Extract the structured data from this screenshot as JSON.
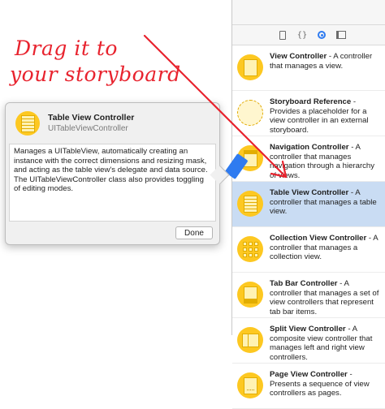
{
  "annotation": {
    "line1": "Drag it to",
    "line2": "your storyboard",
    "color": "#e8232e"
  },
  "library": {
    "tabs": [
      {
        "icon": "file-icon"
      },
      {
        "icon": "braces-icon",
        "label": "{}"
      },
      {
        "icon": "object-library-icon",
        "active": true
      },
      {
        "icon": "media-icon"
      }
    ],
    "items": [
      {
        "title": "View Controller",
        "desc": " - A controller that manages a view.",
        "icon": "view-controller-icon"
      },
      {
        "title": "Storyboard Reference",
        "desc": " - Provides a placeholder for a view controller in an external storyboard.",
        "icon": "storyboard-reference-icon"
      },
      {
        "title": "Navigation Controller",
        "desc": " - A controller that manages navigation through a hierarchy of views.",
        "icon": "navigation-controller-icon"
      },
      {
        "title": "Table View Controller",
        "desc": " - A controller that manages a table view.",
        "icon": "table-view-controller-icon",
        "selected": true
      },
      {
        "title": "Collection View Controller",
        "desc": " - A controller that manages a collection view.",
        "icon": "collection-view-controller-icon"
      },
      {
        "title": "Tab Bar Controller",
        "desc": " - A controller that manages a set of view controllers that represent tab bar items.",
        "icon": "tab-bar-controller-icon"
      },
      {
        "title": "Split View Controller",
        "desc": " - A composite view controller that manages left and right view controllers.",
        "icon": "split-view-controller-icon"
      },
      {
        "title": "Page View Controller",
        "desc": " - Presents a sequence of view controllers as pages.",
        "icon": "page-view-controller-icon"
      }
    ]
  },
  "popover": {
    "title": "Table View Controller",
    "subtitle": "UITableViewController",
    "description": "Manages a UITableView, automatically creating an instance with the correct dimensions and resizing mask, and acting as the table view's delegate and data source. The UITableViewController class also provides toggling of editing modes.",
    "done_label": "Done"
  },
  "colors": {
    "accent": "#2f7bf0",
    "icon_yellow": "#fdc821",
    "selection": "#c9dcf3"
  }
}
